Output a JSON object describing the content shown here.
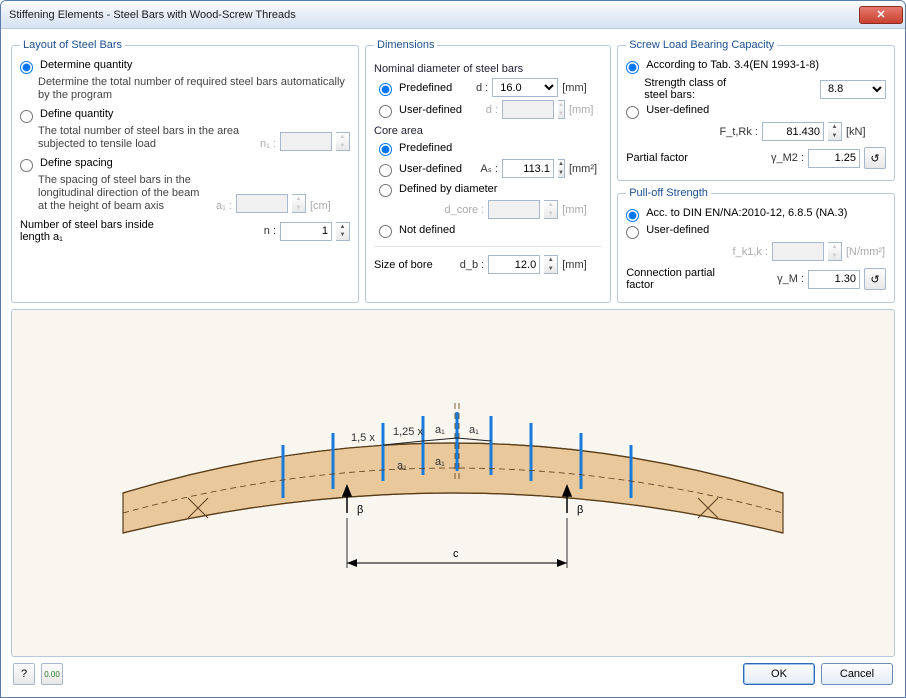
{
  "window": {
    "title": "Stiffening Elements - Steel Bars with Wood-Screw Threads"
  },
  "layout": {
    "legend": "Layout of Steel Bars",
    "opt_determine": "Determine quantity",
    "opt_determine_desc": "Determine the total number of required steel bars automatically by the program",
    "opt_define_qty": "Define quantity",
    "opt_define_qty_desc": "The total number of steel bars in the area subjected to tensile load",
    "n1_sym": "n₁ :",
    "n1_val": "",
    "opt_define_spacing": "Define spacing",
    "opt_define_spacing_desc": "The spacing of steel bars in the longitudinal direction of the beam at the height of beam axis",
    "a1_sym": "a₁ :",
    "a1_val": "",
    "a1_unit": "[cm]",
    "count_label": "Number of steel bars inside length a₁",
    "n_sym": "n :",
    "n_val": "1"
  },
  "dim": {
    "legend": "Dimensions",
    "nom_head": "Nominal diameter of steel bars",
    "predef": "Predefined",
    "userdef": "User-defined",
    "d_sym": "d :",
    "d_val": "16.0",
    "d_unit": "[mm]",
    "core_head": "Core area",
    "as_sym": "Aₛ :",
    "as_val": "113.1",
    "as_unit": "[mm²]",
    "def_by_dia": "Defined by diameter",
    "dcore_sym": "d_core :",
    "dcore_unit": "[mm]",
    "not_def": "Not defined",
    "bore_label": "Size of bore",
    "db_sym": "d_b :",
    "db_val": "12.0",
    "db_unit": "[mm]"
  },
  "screw": {
    "legend": "Screw Load Bearing Capacity",
    "opt_tab": "According to Tab. 3.4(EN 1993-1-8)",
    "strength_label": "Strength class of steel bars:",
    "strength_val": "8.8",
    "opt_user": "User-defined",
    "ftrk_sym": "F_t,Rk :",
    "ftrk_val": "81.430",
    "ftrk_unit": "[kN]",
    "partial_label": "Partial factor",
    "gm2_sym": "γ_M2 :",
    "gm2_val": "1.25"
  },
  "pulloff": {
    "legend": "Pull-off Strength",
    "opt_din": "Acc. to DIN EN/NA:2010-12, 6.8.5 (NA.3)",
    "opt_user": "User-defined",
    "fk1k_sym": "f_k1,k :",
    "fk1k_unit": "[N/mm²]",
    "conn_label": "Connection partial factor",
    "gm_sym": "γ_M :",
    "gm_val": "1.30"
  },
  "diagram": {
    "a1": "a₁",
    "mult15": "1,5 x",
    "mult125": "1,25 x",
    "beta": "β",
    "c": "c"
  },
  "footer": {
    "ok": "OK",
    "cancel": "Cancel"
  }
}
